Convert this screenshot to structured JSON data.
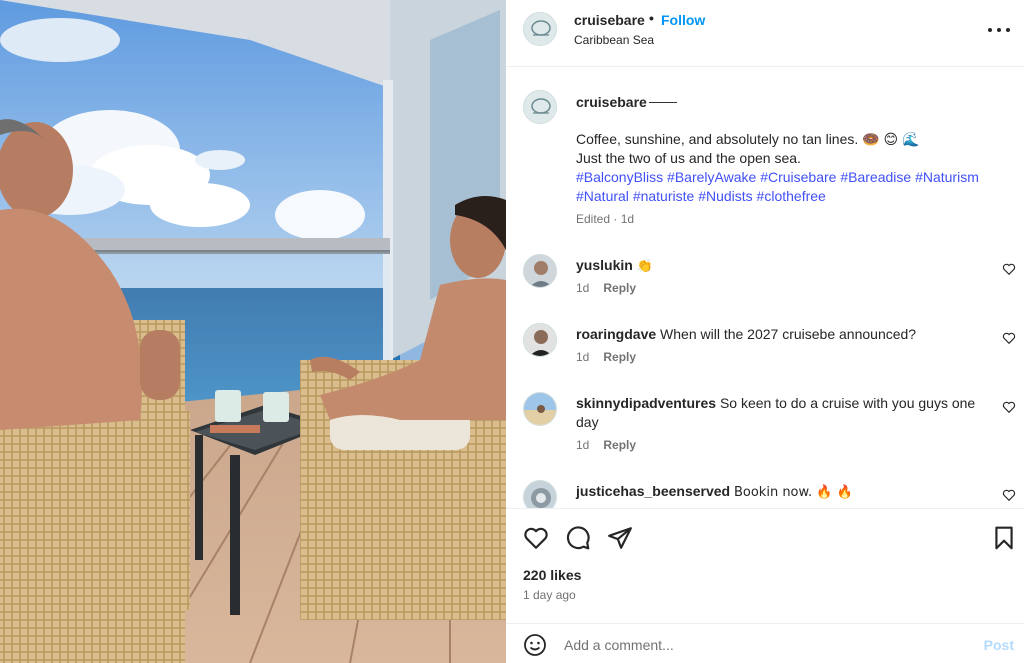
{
  "header": {
    "username": "cruisebare",
    "separator": "•",
    "follow_label": "Follow",
    "location": "Caribbean Sea",
    "more_icon": "more-horizontal-icon"
  },
  "caption": {
    "username": "cruisebare",
    "dash": "——",
    "line1": "Coffee, sunshine, and absolutely no tan lines. 🍩 😊 🌊",
    "line2": "Just the two of us and the open sea.",
    "hashtags": [
      "#BalconyBliss",
      "#BarelyAwake",
      "#Cruisebare",
      "#Bareadise",
      "#Naturism",
      "#Natural",
      "#naturiste",
      "#Nudists",
      "#clothefree"
    ],
    "meta": "Edited · 1d"
  },
  "comments": [
    {
      "username": "yuslukin",
      "text": "👏",
      "time": "1d",
      "reply_label": "Reply"
    },
    {
      "username": "roaringdave",
      "text": "When will the 2027 cruisebe announced?",
      "time": "1d",
      "reply_label": "Reply"
    },
    {
      "username": "skinnydipadventures",
      "text": "So keen to do a cruise with you guys one day",
      "time": "1d",
      "reply_label": "Reply"
    },
    {
      "username": "justicehas_beenserved",
      "text": "Bookin now. 🔥 🔥"
    }
  ],
  "actions": {
    "icons": [
      "heart-icon",
      "comment-icon",
      "share-icon",
      "bookmark-icon"
    ],
    "likes": "220 likes",
    "time_ago": "1 day ago"
  },
  "add_comment": {
    "placeholder": "Add a comment...",
    "post_label": "Post"
  },
  "colors": {
    "link_blue": "#0095f6",
    "hashtag_blue": "#4150f7",
    "muted": "#737373",
    "post_disabled": "#b3dbff"
  }
}
